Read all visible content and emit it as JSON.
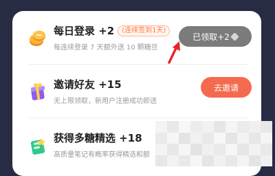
{
  "tasks": [
    {
      "title": "每日登录 +2",
      "badge": "(连续签到1天)",
      "subtitle": "每连续登录 7 天额外送 10 颗糖豆",
      "button": "已领取+2",
      "icon": "coins-icon"
    },
    {
      "title": "邀请好友 +15",
      "subtitle": "无上限领取，新用户注册成功即送",
      "button": "去邀请",
      "icon": "gift-box-icon"
    },
    {
      "title": "获得多糖精选 +18",
      "subtitle": "高质量笔记有概率获得精选和额",
      "icon": "book-icon"
    }
  ],
  "colors": {
    "background": "#272c44",
    "accent": "#f46a4f",
    "claimed": "#7b7b7b",
    "annotation_arrow": "#e8242a"
  }
}
